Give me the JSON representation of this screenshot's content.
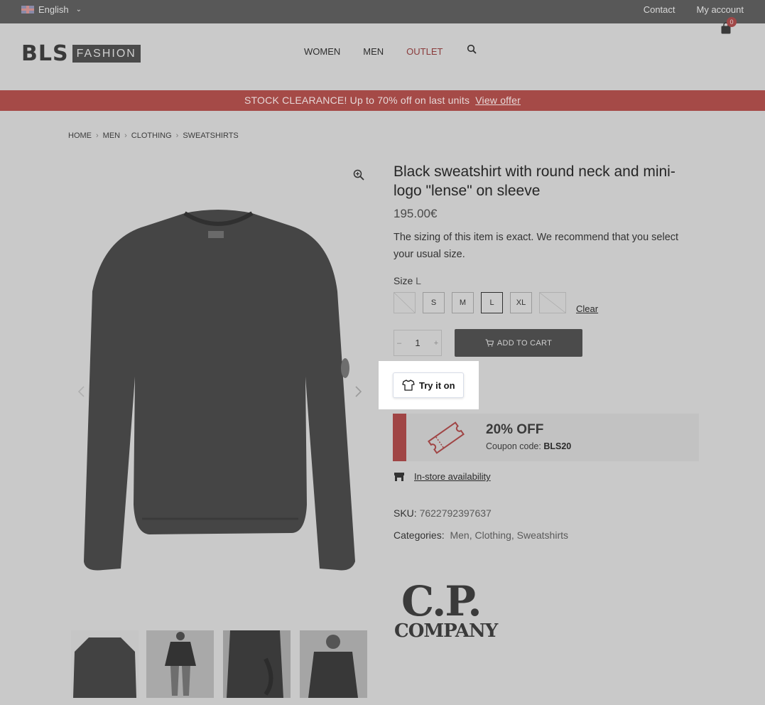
{
  "topbar": {
    "language": "English",
    "links": [
      "Contact",
      "My account"
    ]
  },
  "header": {
    "logo_main": "BLS",
    "logo_sub": "FASHION",
    "nav": [
      "WOMEN",
      "MEN",
      "OUTLET"
    ],
    "cart_count": "0"
  },
  "promo": {
    "text": "STOCK CLEARANCE! Up to 70% off on last units",
    "link": "View offer"
  },
  "breadcrumb": [
    "HOME",
    "MEN",
    "CLOTHING",
    "SWEATSHIRTS"
  ],
  "product": {
    "title": "Black sweatshirt with round neck and mini-logo \"lense\" on sleeve",
    "price": "195.00€",
    "description": "The sizing of this item is exact. We recommend that you select your usual size.",
    "size_label": "Size",
    "size_selected": "L",
    "sizes": [
      "S",
      "M",
      "L",
      "XL"
    ],
    "clear": "Clear",
    "quantity": "1",
    "add_to_cart": "ADD TO CART",
    "try_on": "Try it on",
    "coupon_title": "20% OFF",
    "coupon_label": "Coupon code:",
    "coupon_code": "BLS20",
    "store_availability": "In-store availability",
    "sku_label": "SKU:",
    "sku": "7622792397637",
    "categories_label": "Categories:",
    "categories": "Men, Clothing, Sweatshirts",
    "brand_top": "C.P.",
    "brand_bottom": "COMPANY"
  },
  "colors": {
    "accent": "#a54a47",
    "overlay": "#c9c9c9"
  }
}
